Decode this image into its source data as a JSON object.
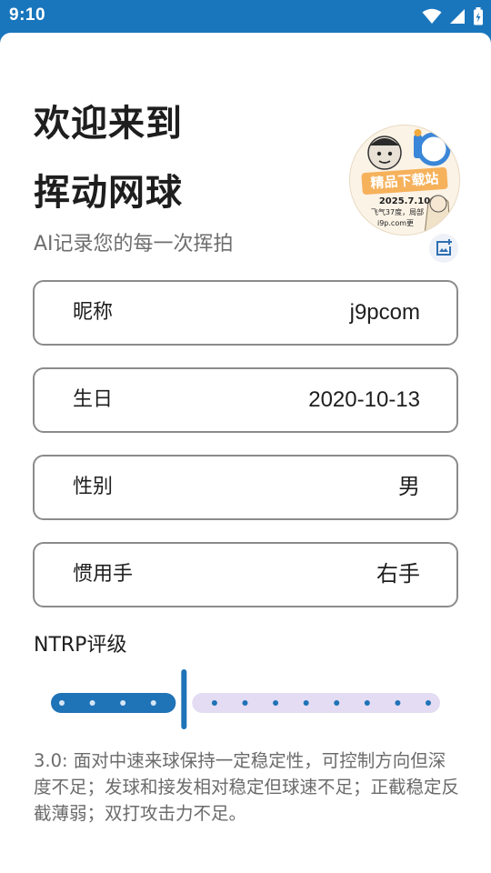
{
  "status_bar": {
    "time": "9:10",
    "icons": [
      "wifi-icon",
      "cell-signal-icon",
      "battery-icon"
    ],
    "background": "#1976bd"
  },
  "header": {
    "welcome_line1": "欢迎来到",
    "welcome_line2": "挥动网球",
    "subtitle": "AI记录您的每一次挥拍"
  },
  "avatar": {
    "stamp_text": "精品下载站",
    "line1": "2025.7.10",
    "line2": "飞气37度，局部",
    "line3": "i9p.com更",
    "edit_icon": "image-edit-icon"
  },
  "form": {
    "fields": [
      {
        "label": "昵称",
        "value": "j9pcom"
      },
      {
        "label": "生日",
        "value": "2020-10-13"
      },
      {
        "label": "性别",
        "value": "男"
      },
      {
        "label": "惯用手",
        "value": "右手"
      }
    ]
  },
  "ntrp": {
    "label": "NTRP评级",
    "min": 1.0,
    "max": 7.0,
    "step": 0.5,
    "value": 3.0,
    "active_color": "#1f73b7",
    "inactive_color": "#e4dcf2",
    "description": "3.0: 面对中速来球保持一定稳定性，可控制方向但深度不足；发球和接发相对稳定但球速不足；正截稳定反截薄弱；双打攻击力不足。"
  }
}
